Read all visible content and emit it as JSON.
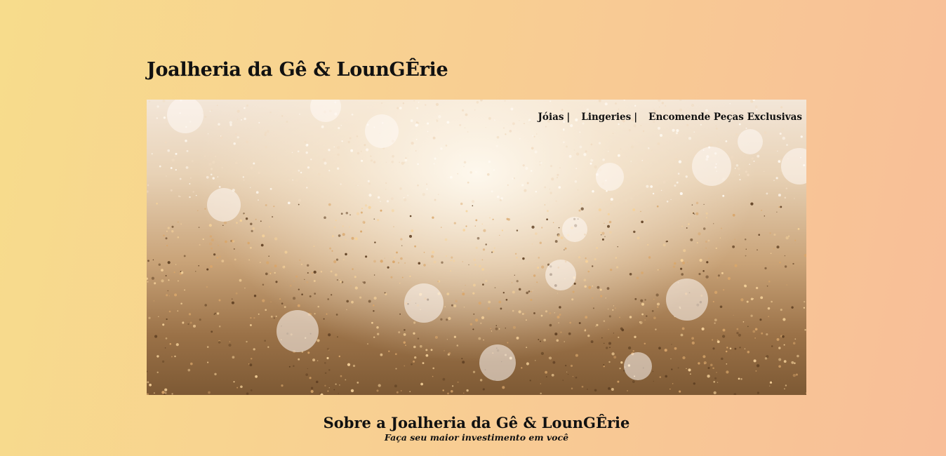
{
  "site": {
    "title": "Joalheria da Gê & LounGÊrie"
  },
  "nav": {
    "items": [
      {
        "label": "Jóias",
        "separator": "|"
      },
      {
        "label": "Lingeries",
        "separator": "|"
      },
      {
        "label": "Encomende Peças Exclusivas",
        "separator": ""
      }
    ]
  },
  "hero": {
    "image": "glitter-bokeh-banner"
  },
  "about": {
    "title": "Sobre a Joalheria da Gê & LounGÊrie",
    "subtitle": "Faça seu maior investimento em você"
  },
  "colors": {
    "background_left": "#f7dc8c",
    "background_right": "#f8be98",
    "text": "#111111"
  }
}
